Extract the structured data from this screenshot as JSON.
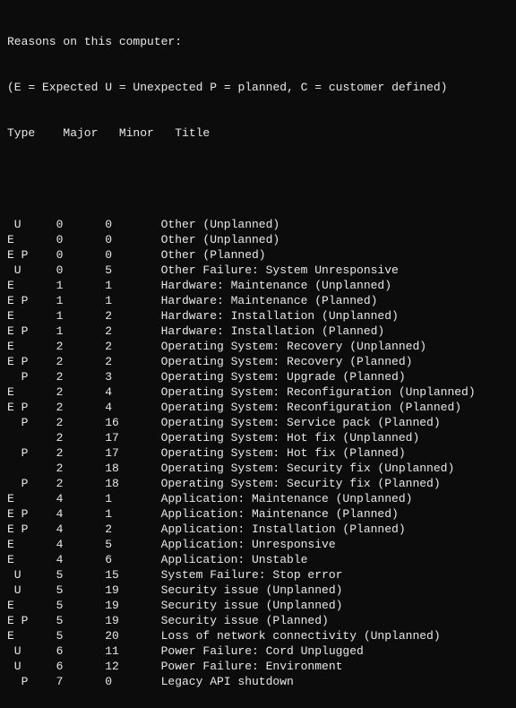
{
  "header": {
    "line1": "Reasons on this computer:",
    "line2": "(E = Expected U = Unexpected P = planned, C = customer defined)"
  },
  "columns": {
    "type": "Type",
    "major": "Major",
    "minor": "Minor",
    "title": "Title"
  },
  "rows": [
    {
      "type": " U",
      "major": "0",
      "minor": "0",
      "title": "Other (Unplanned)"
    },
    {
      "type": "E",
      "major": "0",
      "minor": "0",
      "title": "Other (Unplanned)"
    },
    {
      "type": "E P",
      "major": "0",
      "minor": "0",
      "title": "Other (Planned)"
    },
    {
      "type": " U",
      "major": "0",
      "minor": "5",
      "title": "Other Failure: System Unresponsive"
    },
    {
      "type": "E",
      "major": "1",
      "minor": "1",
      "title": "Hardware: Maintenance (Unplanned)"
    },
    {
      "type": "E P",
      "major": "1",
      "minor": "1",
      "title": "Hardware: Maintenance (Planned)"
    },
    {
      "type": "E",
      "major": "1",
      "minor": "2",
      "title": "Hardware: Installation (Unplanned)"
    },
    {
      "type": "E P",
      "major": "1",
      "minor": "2",
      "title": "Hardware: Installation (Planned)"
    },
    {
      "type": "E",
      "major": "2",
      "minor": "2",
      "title": "Operating System: Recovery (Unplanned)"
    },
    {
      "type": "E P",
      "major": "2",
      "minor": "2",
      "title": "Operating System: Recovery (Planned)"
    },
    {
      "type": "  P",
      "major": "2",
      "minor": "3",
      "title": "Operating System: Upgrade (Planned)"
    },
    {
      "type": "E",
      "major": "2",
      "minor": "4",
      "title": "Operating System: Reconfiguration (Unplanned)"
    },
    {
      "type": "E P",
      "major": "2",
      "minor": "4",
      "title": "Operating System: Reconfiguration (Planned)"
    },
    {
      "type": "  P",
      "major": "2",
      "minor": "16",
      "title": "Operating System: Service pack (Planned)"
    },
    {
      "type": "",
      "major": "2",
      "minor": "17",
      "title": "Operating System: Hot fix (Unplanned)"
    },
    {
      "type": "  P",
      "major": "2",
      "minor": "17",
      "title": "Operating System: Hot fix (Planned)"
    },
    {
      "type": "",
      "major": "2",
      "minor": "18",
      "title": "Operating System: Security fix (Unplanned)"
    },
    {
      "type": "  P",
      "major": "2",
      "minor": "18",
      "title": "Operating System: Security fix (Planned)"
    },
    {
      "type": "E",
      "major": "4",
      "minor": "1",
      "title": "Application: Maintenance (Unplanned)"
    },
    {
      "type": "E P",
      "major": "4",
      "minor": "1",
      "title": "Application: Maintenance (Planned)"
    },
    {
      "type": "E P",
      "major": "4",
      "minor": "2",
      "title": "Application: Installation (Planned)"
    },
    {
      "type": "E",
      "major": "4",
      "minor": "5",
      "title": "Application: Unresponsive"
    },
    {
      "type": "E",
      "major": "4",
      "minor": "6",
      "title": "Application: Unstable"
    },
    {
      "type": " U",
      "major": "5",
      "minor": "15",
      "title": "System Failure: Stop error"
    },
    {
      "type": " U",
      "major": "5",
      "minor": "19",
      "title": "Security issue (Unplanned)"
    },
    {
      "type": "E",
      "major": "5",
      "minor": "19",
      "title": "Security issue (Unplanned)"
    },
    {
      "type": "E P",
      "major": "5",
      "minor": "19",
      "title": "Security issue (Planned)"
    },
    {
      "type": "E",
      "major": "5",
      "minor": "20",
      "title": "Loss of network connectivity (Unplanned)"
    },
    {
      "type": " U",
      "major": "6",
      "minor": "11",
      "title": "Power Failure: Cord Unplugged"
    },
    {
      "type": " U",
      "major": "6",
      "minor": "12",
      "title": "Power Failure: Environment"
    },
    {
      "type": "  P",
      "major": "7",
      "minor": "0",
      "title": "Legacy API shutdown"
    }
  ]
}
